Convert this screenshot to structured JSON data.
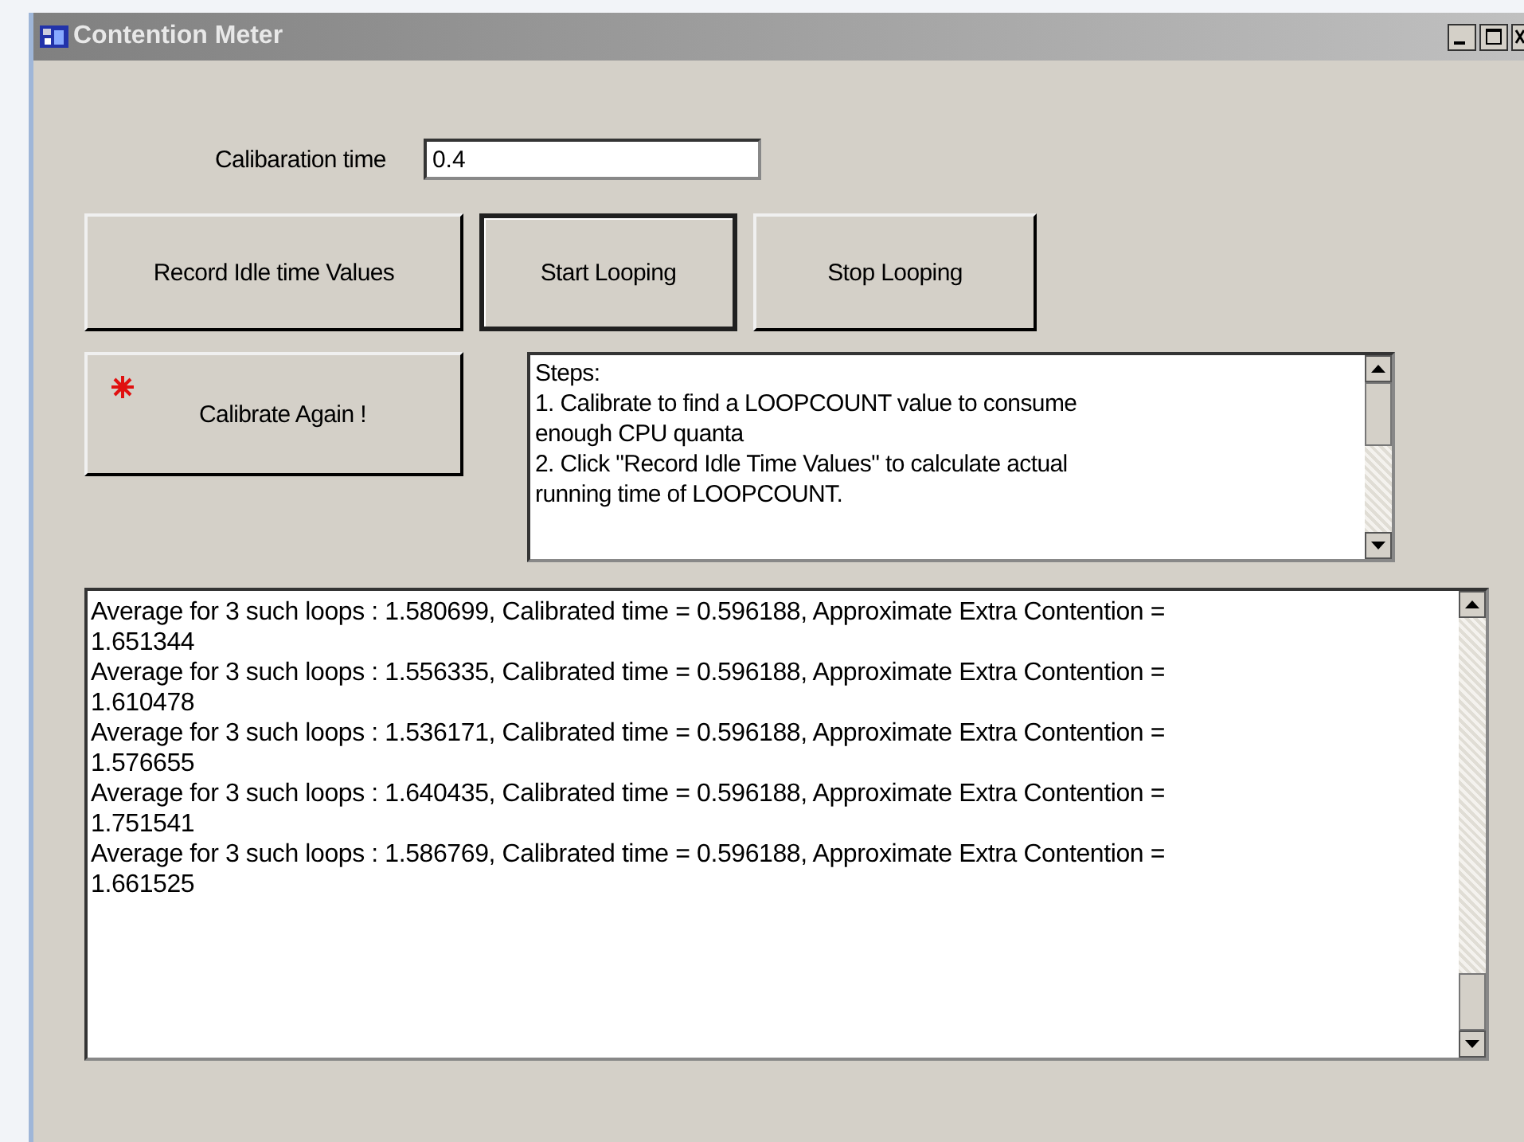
{
  "window": {
    "title": "Contention Meter"
  },
  "calibration": {
    "label": "Calibaration time",
    "value": "0.4"
  },
  "buttons": [
    {
      "label": "Record Idle time Values",
      "selected": false
    },
    {
      "label": "Start Looping",
      "selected": true
    },
    {
      "label": "Stop Looping",
      "selected": false
    }
  ],
  "calibrate_button": {
    "label": "Calibrate Again !"
  },
  "steps": [
    "Steps:",
    "1. Calibrate to find a LOOPCOUNT value to consume enough CPU quanta",
    "2. Click \"Record Idle Time Values\" to calculate actual running time of LOOPCOUNT."
  ],
  "log": [
    "Average for 3 such loops : 1.580699, Calibrated time = 0.596188, Approximate Extra Contention = 1.651344",
    "Average for 3 such loops : 1.556335, Calibrated time = 0.596188, Approximate Extra Contention = 1.610478",
    "Average for 3 such loops : 1.536171, Calibrated time = 0.596188, Approximate Extra Contention = 1.576655",
    "Average for 3 such loops : 1.640435, Calibrated time = 0.596188, Approximate Extra Contention = 1.751541",
    "Average for 3 such loops : 1.586769, Calibrated time = 0.596188, Approximate Extra Contention = 1.661525"
  ]
}
